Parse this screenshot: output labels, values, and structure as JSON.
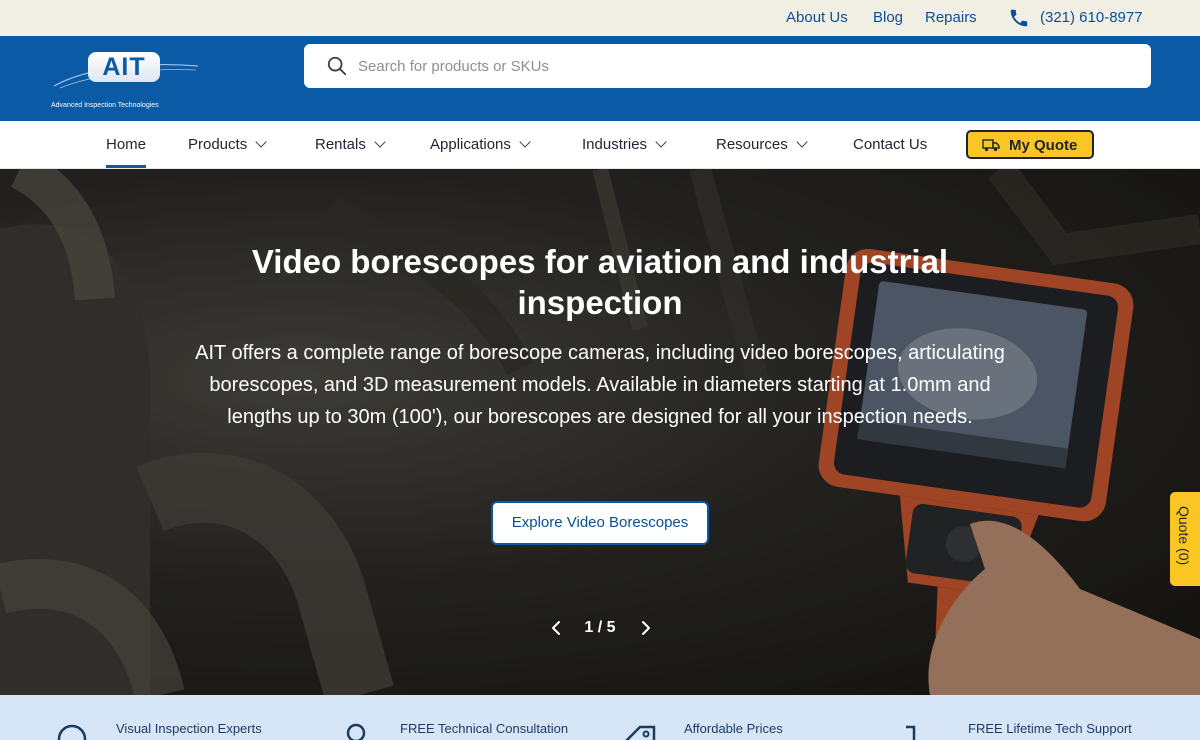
{
  "topbar": {
    "links": [
      {
        "label": "About Us"
      },
      {
        "label": "Blog"
      },
      {
        "label": "Repairs"
      }
    ],
    "phone": "(321) 610-8977"
  },
  "brand": {
    "logo_text": "AIT",
    "tagline": "Advanced Inspection Technologies"
  },
  "search": {
    "placeholder": "Search for products or SKUs"
  },
  "nav": {
    "items": [
      {
        "label": "Home",
        "active": true
      },
      {
        "label": "Products"
      },
      {
        "label": "Rentals"
      },
      {
        "label": "Applications"
      },
      {
        "label": "Industries"
      },
      {
        "label": "Resources"
      },
      {
        "label": "Contact Us"
      }
    ],
    "quote_button": "My Quote"
  },
  "hero": {
    "title": "Video borescopes for aviation and industrial inspection",
    "description": "AIT offers a complete range of borescope cameras, including video borescopes, articulating borescopes, and 3D measurement models. Available in diameters starting at 1.0mm and lengths up to 30m (100'), our borescopes are designed for all your inspection needs.",
    "cta": "Explore Video Borescopes",
    "slide_counter": "1 / 5"
  },
  "quote_tab": "Quote (0)",
  "features": [
    {
      "label": "Visual Inspection Experts",
      "icon": "magnifier-icon"
    },
    {
      "label": "FREE Technical Consultation",
      "icon": "person-icon"
    },
    {
      "label": "Affordable Prices",
      "icon": "price-tag-icon"
    },
    {
      "label": "FREE Lifetime Tech Support",
      "icon": "headset-icon"
    }
  ],
  "colors": {
    "brand_blue": "#0a5aa6",
    "accent_yellow": "#f9c623",
    "topbar_bg": "#f1efe4",
    "features_bg": "#d6e6f6"
  }
}
